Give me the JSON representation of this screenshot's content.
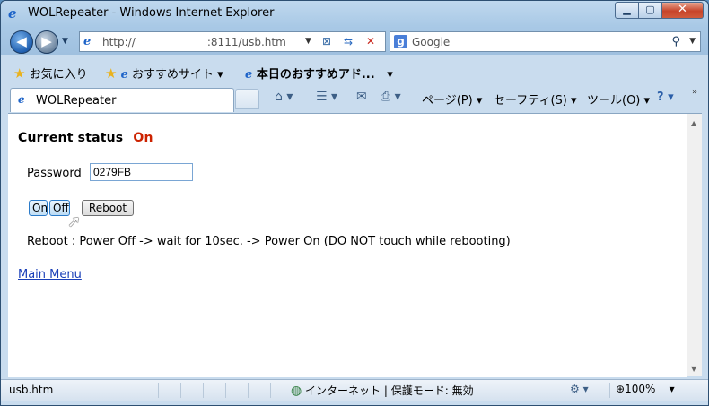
{
  "window": {
    "title": "WOLRepeater - Windows Internet Explorer",
    "controls": {
      "minimize": "▁",
      "maximize": "▢",
      "close": "✕"
    }
  },
  "address_bar": {
    "url_prefix": "http://",
    "url_suffix": ":8111/usb.htm",
    "search_engine": "Google"
  },
  "favorites_bar": {
    "favorites_label": "お気に入り",
    "recommended_sites": "おすすめサイト",
    "todays_picks": "本日のおすすめアド..."
  },
  "tab": {
    "title": "WOLRepeater"
  },
  "command_bar": {
    "page": "ページ(P)",
    "safety": "セーフティ(S)",
    "tools": "ツール(O)",
    "help": "?"
  },
  "page": {
    "status_label": "Current status",
    "status_value": "On",
    "password_label": "Password",
    "password_value": "0279FB",
    "on_button": "On",
    "off_button": "Off",
    "reboot_button": "Reboot",
    "reboot_note": "Reboot : Power Off -> wait for 10sec. -> Power On (DO NOT touch while rebooting)",
    "main_menu_link": "Main Menu"
  },
  "status_bar": {
    "left_text": "usb.htm",
    "zone_text": "インターネット | 保護モード: 無効",
    "zoom": "100%"
  },
  "colors": {
    "status_on": "#cc2200",
    "link": "#1a3fb8",
    "chrome_blue": "#a9c9e6"
  }
}
